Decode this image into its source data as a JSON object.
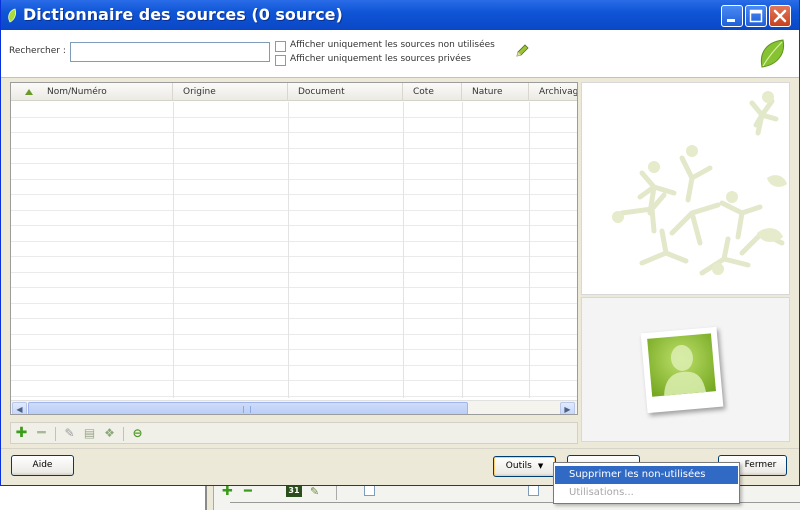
{
  "window": {
    "title": "Dictionnaire des sources (0 source)"
  },
  "search": {
    "label": "Rechercher :",
    "value": "",
    "checkbox_unused_label": "Afficher uniquement les sources non utilisées",
    "checkbox_unused_checked": false,
    "checkbox_private_label": "Afficher uniquement les sources privées",
    "checkbox_private_checked": false
  },
  "grid": {
    "columns": [
      "Nom/Numéro",
      "Origine",
      "Document",
      "Cote",
      "Nature",
      "Archivag"
    ],
    "sorted_column": "Nom/Numéro",
    "sort_direction": "ascending",
    "rows": []
  },
  "grid_toolbar": {
    "icons": [
      "add-icon",
      "remove-icon",
      "edit-icon",
      "copy-icon",
      "merge-icon",
      "print-icon"
    ]
  },
  "buttons": {
    "help": "Aide",
    "tools": "Outils",
    "close": "Fermer"
  },
  "tools_menu": {
    "items": [
      {
        "label": "Supprimer les non-utilisées",
        "enabled": true,
        "highlighted": true
      },
      {
        "label": "Utilisations...",
        "enabled": false,
        "highlighted": false
      }
    ]
  },
  "background_app": {
    "calendar_text": "31"
  },
  "colors": {
    "titlebar": "#0f55d6",
    "accent_green": "#7dbb1f",
    "menu_highlight": "#316ac5"
  }
}
